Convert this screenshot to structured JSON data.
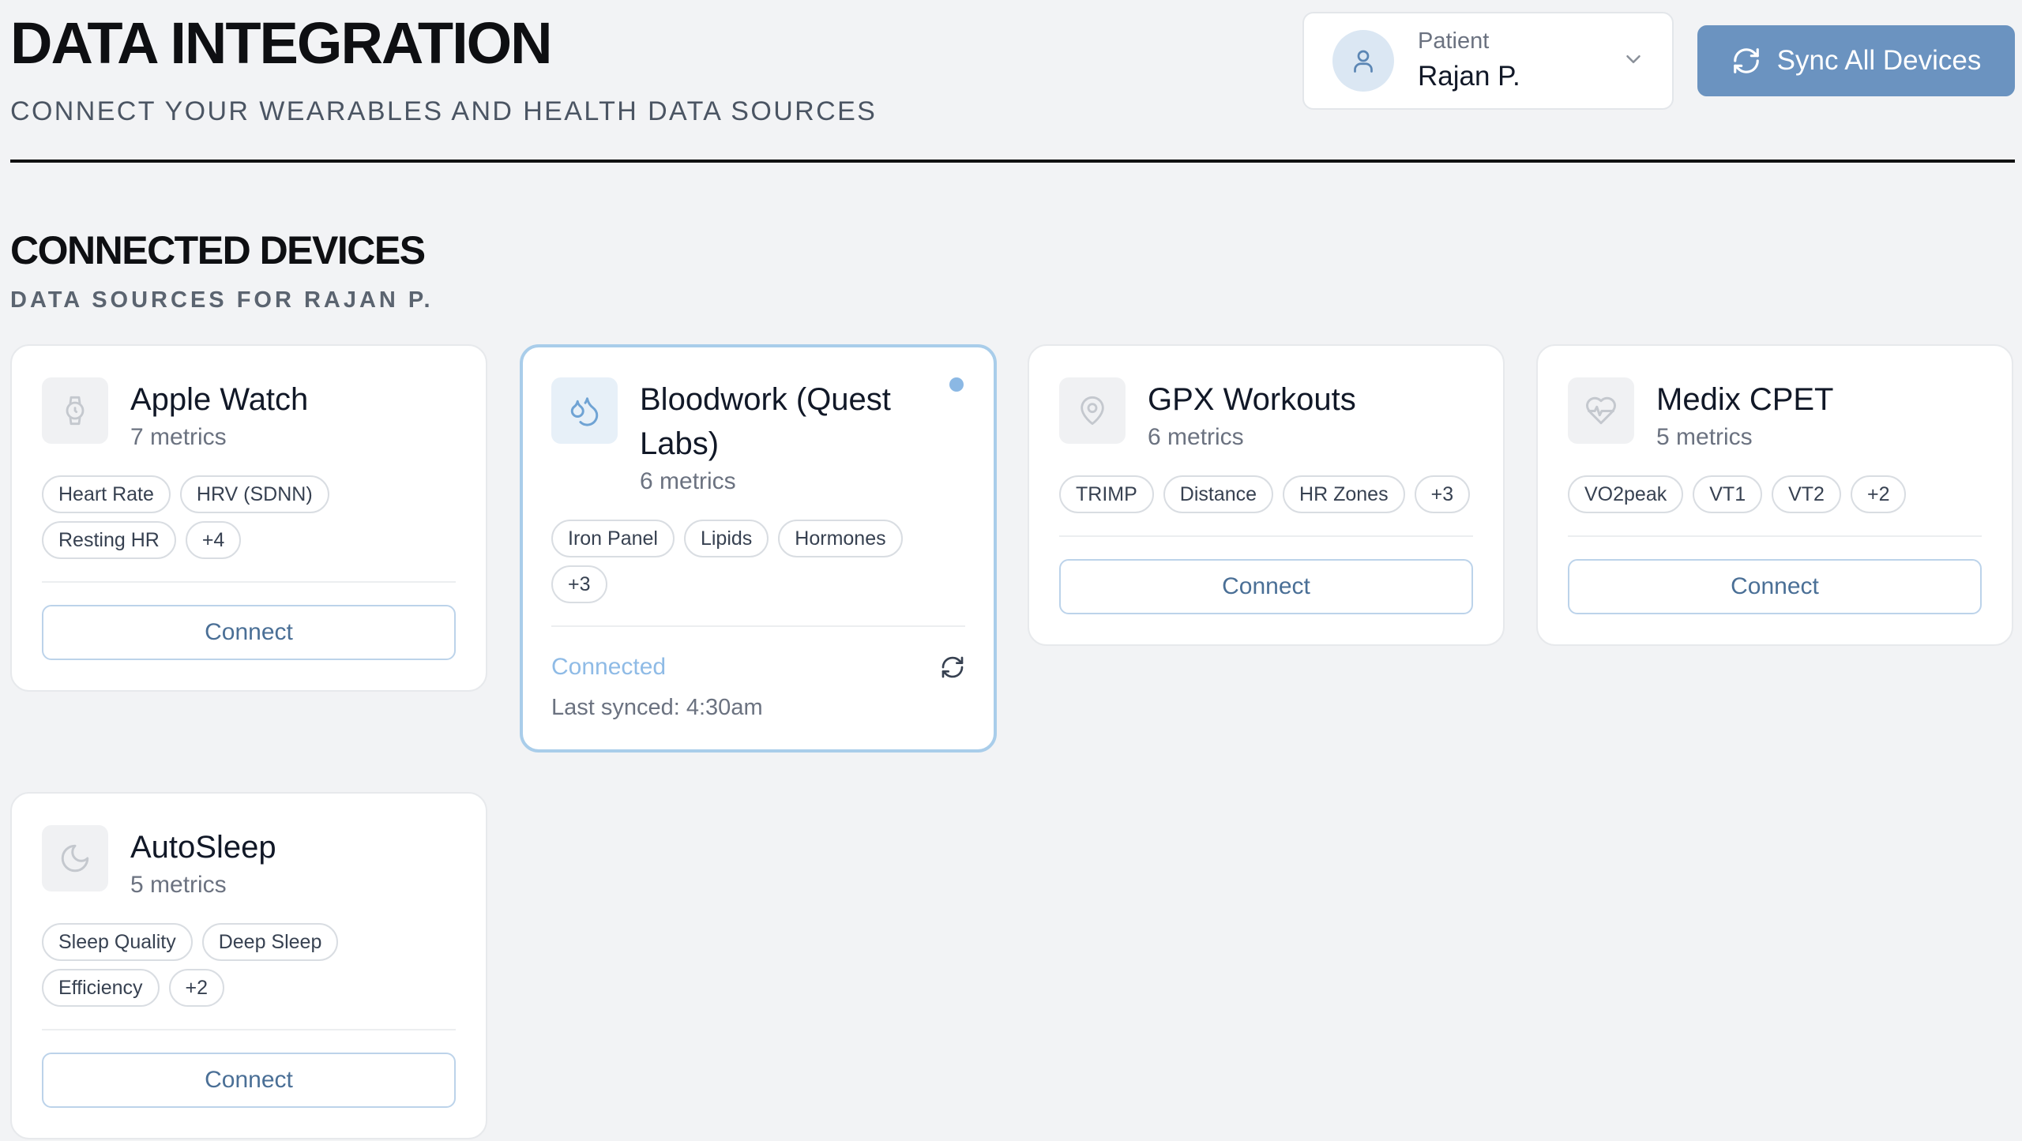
{
  "header": {
    "title": "DATA INTEGRATION",
    "subtitle": "CONNECT YOUR WEARABLES AND HEALTH DATA SOURCES",
    "patient_label": "Patient",
    "patient_name": "Rajan P.",
    "sync_all_label": "Sync All Devices"
  },
  "section": {
    "title": "CONNECTED DEVICES",
    "subtitle": "DATA SOURCES FOR RAJAN P."
  },
  "devices": [
    {
      "name": "Apple Watch",
      "metrics": "7 metrics",
      "icon": "watch-icon",
      "tags": [
        "Heart Rate",
        "HRV (SDNN)",
        "Resting HR",
        "+4"
      ],
      "action": "Connect"
    },
    {
      "name": "Bloodwork (Quest Labs)",
      "metrics": "6 metrics",
      "icon": "droplets-icon",
      "tags": [
        "Iron Panel",
        "Lipids",
        "Hormones",
        "+3"
      ],
      "status": "Connected",
      "last_synced": "Last synced: 4:30am"
    },
    {
      "name": "GPX Workouts",
      "metrics": "6 metrics",
      "icon": "map-pin-icon",
      "tags": [
        "TRIMP",
        "Distance",
        "HR Zones",
        "+3"
      ],
      "action": "Connect"
    },
    {
      "name": "Medix CPET",
      "metrics": "5 metrics",
      "icon": "heart-pulse-icon",
      "tags": [
        "VO2peak",
        "VT1",
        "VT2",
        "+2"
      ],
      "action": "Connect"
    },
    {
      "name": "AutoSleep",
      "metrics": "5 metrics",
      "icon": "moon-icon",
      "tags": [
        "Sleep Quality",
        "Deep Sleep",
        "Efficiency",
        "+2"
      ],
      "action": "Connect"
    }
  ],
  "colors": {
    "background": "#f2f3f5",
    "accent": "#6b93c0",
    "connected": "#8fbbe6",
    "active_border": "#a9cdea"
  }
}
